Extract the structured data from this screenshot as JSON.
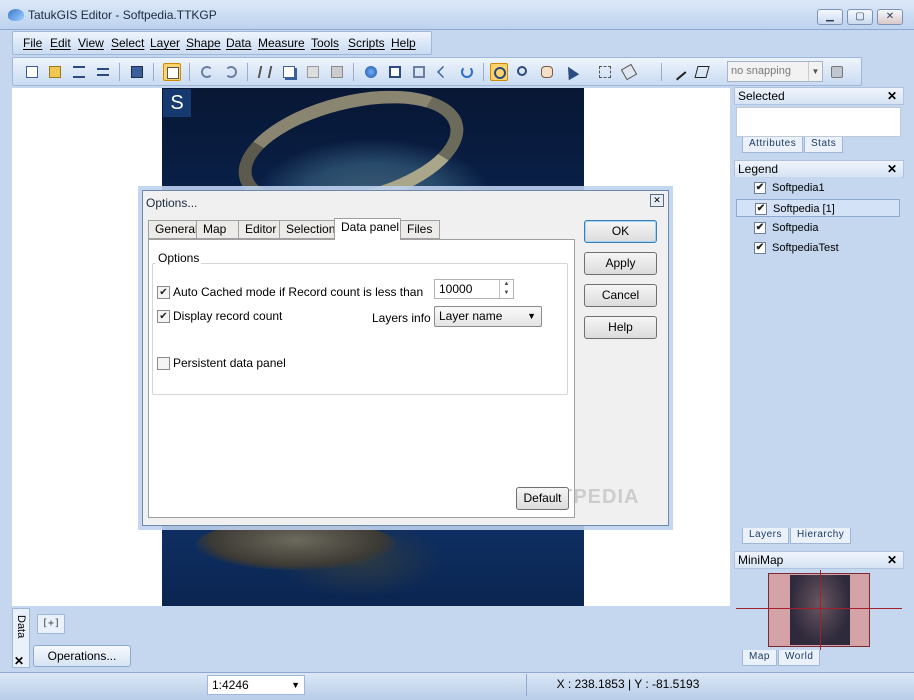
{
  "window": {
    "title": "TatukGIS Editor - Softpedia.TTKGP",
    "min_label": "▁",
    "max_label": "▢",
    "close_label": "✕"
  },
  "menu": {
    "items": [
      {
        "label": "File"
      },
      {
        "label": "Edit"
      },
      {
        "label": "View"
      },
      {
        "label": "Select"
      },
      {
        "label": "Layer"
      },
      {
        "label": "Shape"
      },
      {
        "label": "Data"
      },
      {
        "label": "Measure"
      },
      {
        "label": "Tools"
      },
      {
        "label": "Scripts"
      },
      {
        "label": "Help"
      }
    ]
  },
  "toolbar": {
    "snapping": {
      "value": "no snapping"
    }
  },
  "map": {
    "logo_text": "S"
  },
  "data_panel": {
    "tab_label": "Data",
    "plus_tab": "[+]",
    "operations_button": "Operations..."
  },
  "status": {
    "scale": "1:4246",
    "coords": "X : 238.1853 | Y : -81.5193"
  },
  "selected_panel": {
    "title": "Selected",
    "tabs": [
      "Attributes",
      "Stats"
    ]
  },
  "legend_panel": {
    "title": "Legend",
    "items": [
      {
        "label": "Softpedia1",
        "checked": "✔"
      },
      {
        "label": "Softpedia [1]",
        "checked": "✔"
      },
      {
        "label": "Softpedia",
        "checked": "✔"
      },
      {
        "label": "SoftpediaTest",
        "checked": "✔"
      }
    ],
    "tabs": [
      "Layers",
      "Hierarchy"
    ]
  },
  "minimap_panel": {
    "title": "MiniMap",
    "tabs": [
      "Map",
      "World"
    ]
  },
  "panel_close": "✕",
  "dialog": {
    "title": "Options...",
    "tabs": [
      "General",
      "Map",
      "Editor",
      "Selection",
      "Data panel",
      "Files"
    ],
    "group_label": "Options",
    "auto_cached": {
      "label": "Auto Cached mode if Record count is less than",
      "checked": "✔",
      "value": "10000"
    },
    "display_count": {
      "label": "Display record count",
      "checked": "✔"
    },
    "layers_info": {
      "label": "Layers info :",
      "value": "Layer name"
    },
    "persistent": {
      "label": "Persistent data panel",
      "checked": ""
    },
    "buttons": {
      "ok": "OK",
      "apply": "Apply",
      "cancel": "Cancel",
      "help": "Help",
      "default": "Default"
    },
    "watermark": "SOFTPEDIA"
  },
  "colors": {
    "accent": "#ffd36b",
    "chrome": "#c4d7ef"
  }
}
